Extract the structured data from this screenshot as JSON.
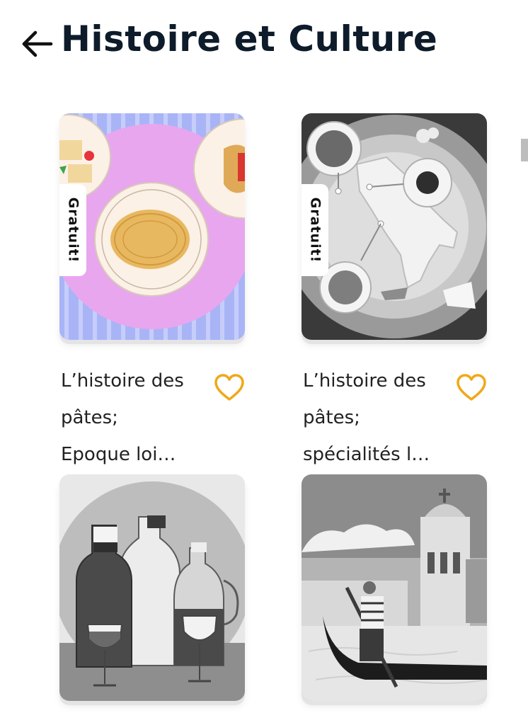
{
  "header": {
    "title": "Histoire et Culture"
  },
  "badge_label": "Gratuit!",
  "cards": [
    {
      "line1": "L’histoire des",
      "line2": "pâtes;",
      "line3": "Epoque loi…",
      "free": true,
      "favorite": false
    },
    {
      "line1": "L’histoire des",
      "line2": "pâtes;",
      "line3": "spécialités l…",
      "free": true,
      "favorite": false
    },
    {
      "free": false
    },
    {
      "free": false
    }
  ],
  "colors": {
    "accent_heart": "#f0a818",
    "title": "#0d1b2a",
    "card1_bg": "#e8a6ee",
    "card1_stripes": "#a8b4f6"
  }
}
